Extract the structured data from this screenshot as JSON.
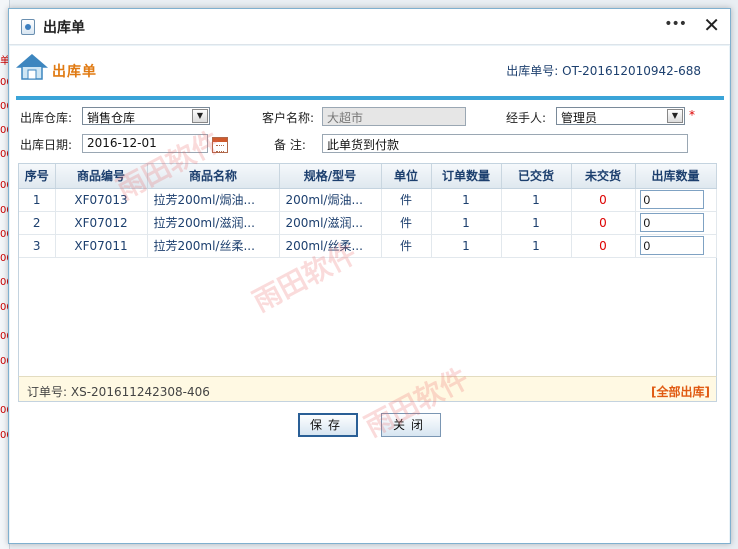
{
  "background_strip": [
    "单",
    "00",
    "00",
    "00",
    "00",
    "00",
    "00",
    "00",
    "00",
    "00",
    "00",
    "00",
    "00",
    "00",
    "00"
  ],
  "window": {
    "title": "出库单",
    "more": "•••",
    "close": "✕"
  },
  "header": {
    "title": "出库单",
    "doc_no_label": "出库单号:",
    "doc_no": "OT-201612010942-688"
  },
  "form": {
    "warehouse_label": "出库仓库:",
    "warehouse_value": "销售仓库",
    "customer_label": "客户名称:",
    "customer_value": "大超市",
    "handler_label": "经手人:",
    "handler_value": "管理员",
    "required_mark": "*",
    "date_label": "出库日期:",
    "date_value": "2016-12-01",
    "remark_label": "备  注:",
    "remark_value": "此单货到付款"
  },
  "table": {
    "columns": [
      "序号",
      "商品编号",
      "商品名称",
      "规格/型号",
      "单位",
      "订单数量",
      "已交货",
      "未交货",
      "出库数量"
    ],
    "rows": [
      {
        "no": "1",
        "code": "XF07013",
        "name": "拉芳200ml/焗油...",
        "spec": "200ml/焗油...",
        "unit": "件",
        "ordered": "1",
        "delivered": "1",
        "pending": "0",
        "qty": "0"
      },
      {
        "no": "2",
        "code": "XF07012",
        "name": "拉芳200ml/滋润...",
        "spec": "200ml/滋润...",
        "unit": "件",
        "ordered": "1",
        "delivered": "1",
        "pending": "0",
        "qty": "0"
      },
      {
        "no": "3",
        "code": "XF07011",
        "name": "拉芳200ml/丝柔...",
        "spec": "200ml/丝柔...",
        "unit": "件",
        "ordered": "1",
        "delivered": "1",
        "pending": "0",
        "qty": "0"
      }
    ]
  },
  "footer": {
    "order_no_label": "订单号:",
    "order_no": "XS-201611242308-406",
    "all_out": "[全部出库]"
  },
  "buttons": {
    "save": "保存",
    "close": "关闭"
  },
  "watermark": "雨田软件",
  "colors": {
    "accent": "#3aa4d8",
    "title_orange": "#e07a12",
    "text_blue": "#1c3f6e",
    "red": "#dd0000"
  }
}
